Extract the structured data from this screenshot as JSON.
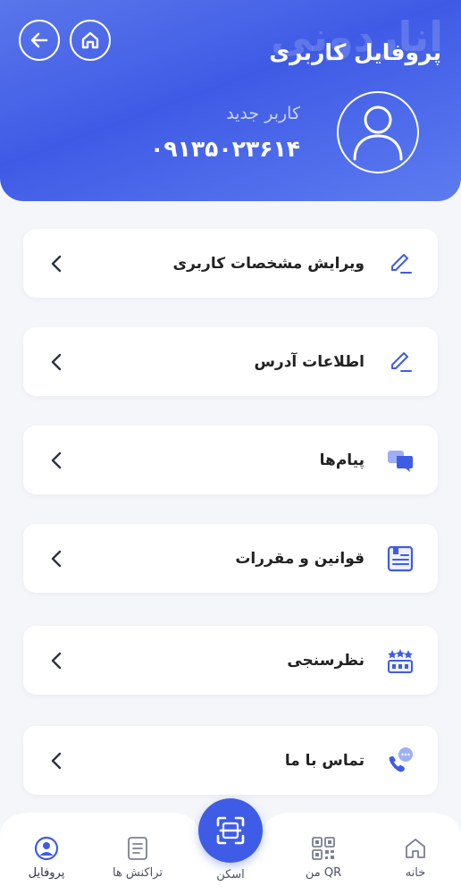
{
  "header": {
    "title": "پروفایل کاربری",
    "watermark": "اناردونی",
    "user_name": "کاربر جدید",
    "user_phone": "۰۹۱۳۵۰۲۳۶۱۴"
  },
  "menu": [
    {
      "label": "ویرایش مشخصات کاربری",
      "icon": "pencil-icon"
    },
    {
      "label": "اطلاعات آدرس",
      "icon": "pencil-icon"
    },
    {
      "label": "پیام‌ها",
      "icon": "chat-bubbles-icon"
    },
    {
      "label": "قوانین و مقررات",
      "icon": "rules-document-icon"
    },
    {
      "label": "نظرسنجی",
      "icon": "rating-stars-icon"
    },
    {
      "label": "تماس با ما",
      "icon": "phone-call-icon"
    }
  ],
  "bottom_nav": {
    "home": "خانه",
    "my_qr": "QR من",
    "scan": "اسکن",
    "transactions": "تراکنش ها",
    "profile": "پروفایل"
  },
  "colors": {
    "accent": "#3f5ce6",
    "header_gradient_start": "#5a76ea",
    "background": "#f5f6fa"
  }
}
